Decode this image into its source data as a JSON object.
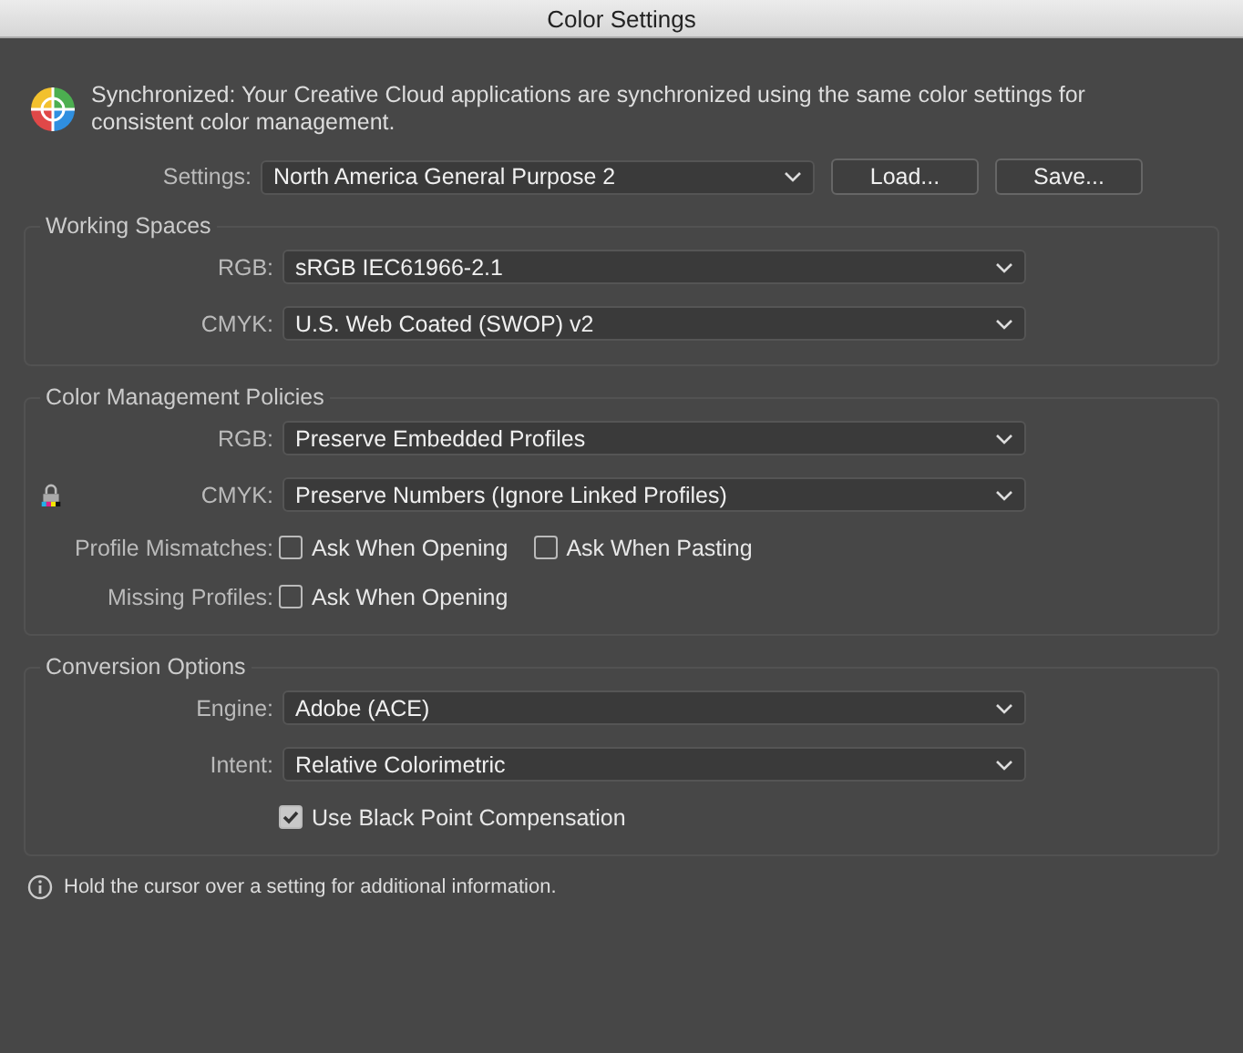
{
  "window": {
    "title": "Color Settings"
  },
  "sync_message": "Synchronized: Your Creative Cloud applications are synchronized using the same color settings for consistent color management.",
  "settings": {
    "label": "Settings:",
    "value": "North America General Purpose 2",
    "buttons": [
      "Load...",
      "Save..."
    ]
  },
  "sections": [
    {
      "title": "Working Spaces",
      "rows": [
        {
          "kind": "select",
          "label": "RGB:",
          "value": "sRGB IEC61966-2.1"
        },
        {
          "kind": "select",
          "label": "CMYK:",
          "value": "U.S. Web Coated (SWOP) v2"
        }
      ]
    },
    {
      "title": "Color Management Policies",
      "rows": [
        {
          "kind": "select",
          "label": "RGB:",
          "value": "Preserve Embedded Profiles"
        },
        {
          "kind": "select",
          "label": "CMYK:",
          "value": "Preserve Numbers (Ignore Linked Profiles)",
          "locked": true
        },
        {
          "kind": "checks",
          "label": "Profile Mismatches:",
          "options": [
            {
              "label": "Ask When Opening",
              "checked": false
            },
            {
              "label": "Ask When Pasting",
              "checked": false
            }
          ]
        },
        {
          "kind": "checks",
          "label": "Missing Profiles:",
          "options": [
            {
              "label": "Ask When Opening",
              "checked": false
            }
          ]
        }
      ]
    },
    {
      "title": "Conversion Options",
      "rows": [
        {
          "kind": "select",
          "label": "Engine:",
          "value": "Adobe (ACE)"
        },
        {
          "kind": "select",
          "label": "Intent:",
          "value": "Relative Colorimetric"
        },
        {
          "kind": "checks",
          "options": [
            {
              "label": "Use Black Point Compensation",
              "checked": true
            }
          ]
        }
      ]
    }
  ],
  "info": "Hold the cursor over a setting for additional information."
}
